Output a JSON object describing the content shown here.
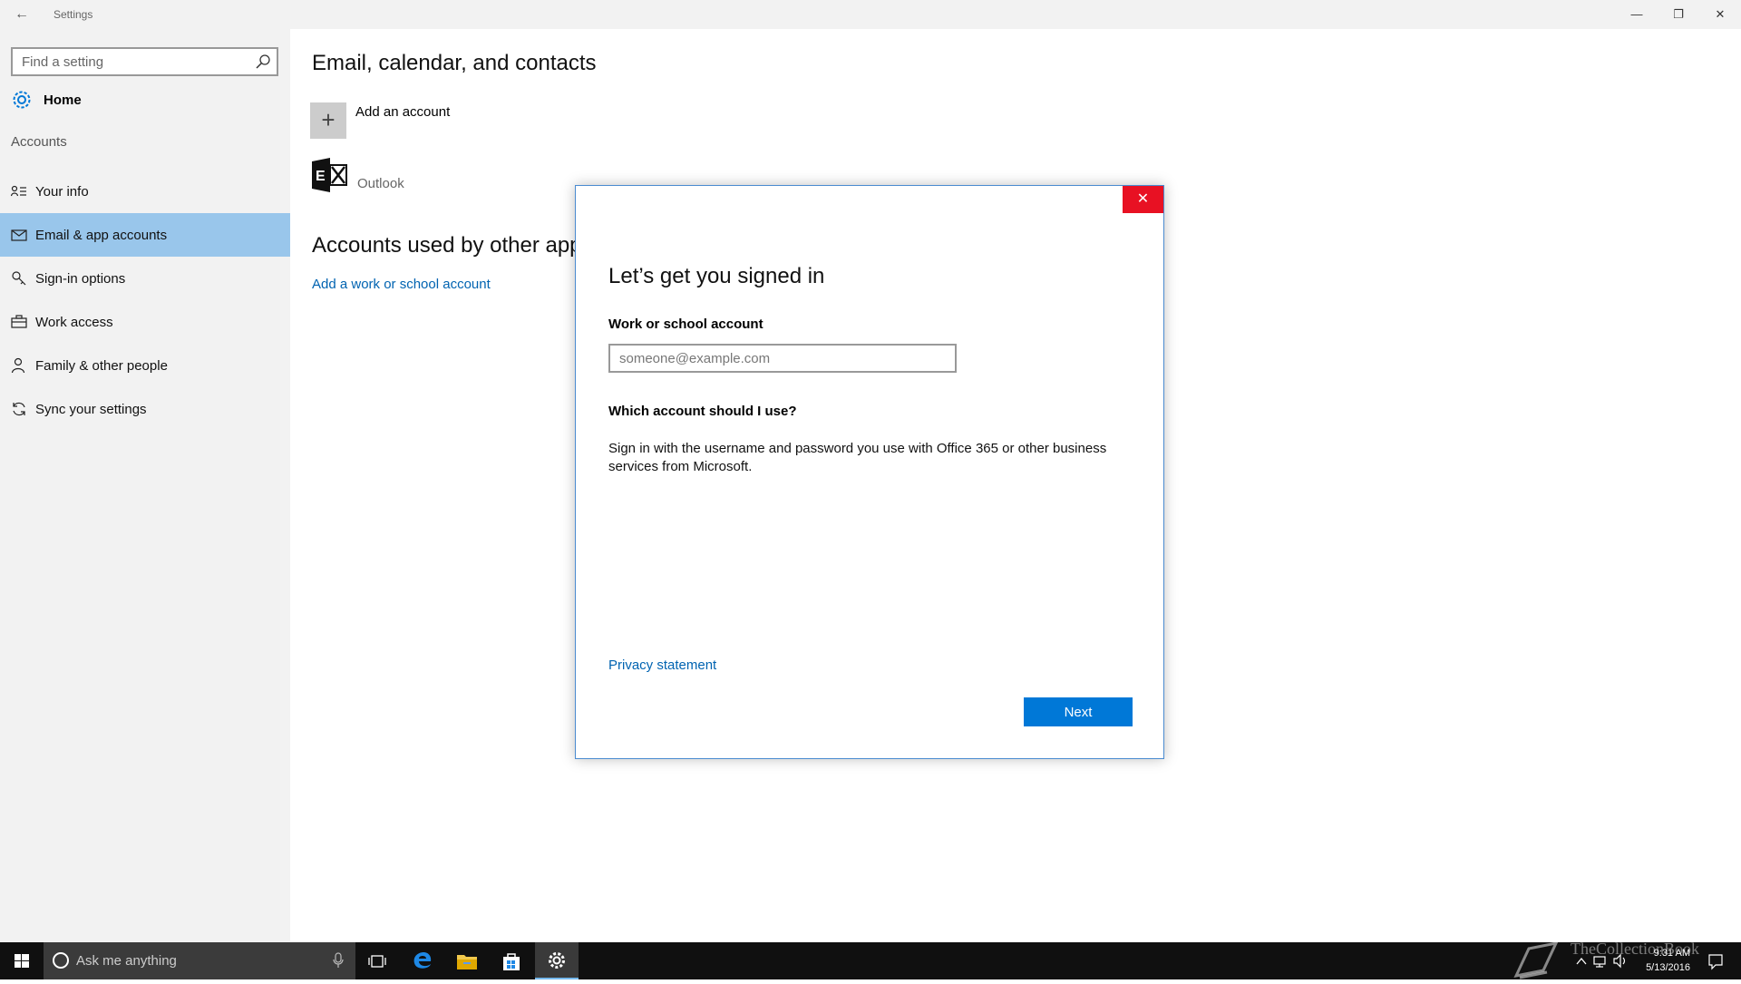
{
  "window": {
    "title": "Settings",
    "minimize_glyph": "—",
    "maximize_glyph": "❐",
    "close_glyph": "✕",
    "back_glyph": "←"
  },
  "sidebar": {
    "search_placeholder": "Find a setting",
    "home_label": "Home",
    "section_title": "Accounts",
    "items": [
      {
        "label": "Your info",
        "icon": "person-card-icon"
      },
      {
        "label": "Email & app accounts",
        "icon": "mail-icon",
        "active": true
      },
      {
        "label": "Sign-in options",
        "icon": "key-icon"
      },
      {
        "label": "Work access",
        "icon": "briefcase-icon"
      },
      {
        "label": "Family & other people",
        "icon": "person-icon"
      },
      {
        "label": "Sync your settings",
        "icon": "sync-icon"
      }
    ]
  },
  "main": {
    "heading": "Email, calendar, and contacts",
    "add_account_label": "Add an account",
    "add_glyph": "+",
    "outlook_label": "Outlook",
    "heading2": "Accounts used by other app",
    "add_work_link": "Add a work or school account"
  },
  "dialog": {
    "close_glyph": "✕",
    "title": "Let’s get you signed in",
    "field_label": "Work or school account",
    "email_placeholder": "someone@example.com",
    "question": "Which account should I use?",
    "description": "Sign in with the username and password you use with Office 365 or other business services from Microsoft.",
    "privacy_link": "Privacy statement",
    "next_label": "Next"
  },
  "taskbar": {
    "search_text": "Ask me anything",
    "time": "9:31 AM",
    "date": "5/13/2016",
    "watermark": "TheCollectionBook"
  },
  "colors": {
    "accent": "#0078d7",
    "link": "#0063b1",
    "active_nav": "#99c6eb",
    "close_red": "#e81123"
  }
}
